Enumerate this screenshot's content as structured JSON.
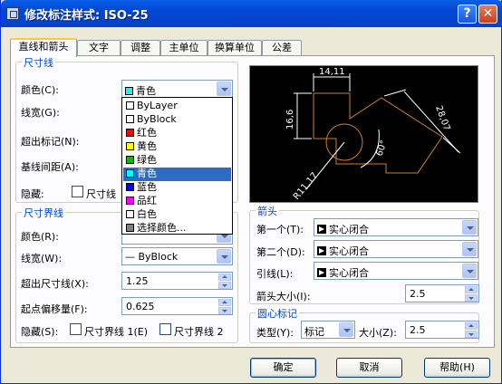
{
  "window": {
    "title": "修改标注样式: ISO-25",
    "help_btn": "?",
    "close_btn": "✕"
  },
  "tabs": [
    "直线和箭头",
    "文字",
    "调整",
    "主单位",
    "换算单位",
    "公差"
  ],
  "dim_lines": {
    "title": "尺寸线",
    "color_label": "颜色(C):",
    "color_value": "青色",
    "lineweight_label": "线宽(G):",
    "extend_label": "超出标记(N):",
    "baseline_label": "基线间距(A):",
    "suppress_label": "隐藏:",
    "suppress_chk": "尺寸线"
  },
  "color_dropdown": {
    "items": [
      {
        "label": "ByLayer",
        "swatch": "#ffffff"
      },
      {
        "label": "ByBlock",
        "swatch": "#ffffff"
      },
      {
        "label": "红色",
        "swatch": "#ff0000"
      },
      {
        "label": "黄色",
        "swatch": "#ffff00"
      },
      {
        "label": "绿色",
        "swatch": "#00c000"
      },
      {
        "label": "青色",
        "swatch": "#00ffff"
      },
      {
        "label": "蓝色",
        "swatch": "#0000ff"
      },
      {
        "label": "品红",
        "swatch": "#ff00ff"
      },
      {
        "label": "白色",
        "swatch": "#ffffff"
      },
      {
        "label": "选择颜色...",
        "swatch": "#808080"
      }
    ],
    "selected": "青色"
  },
  "ext_lines": {
    "title": "尺寸界线",
    "color_label": "颜色(R):",
    "lineweight_label": "线宽(W):",
    "lineweight_value": "— ByBlock",
    "extend_label": "超出尺寸线(X):",
    "extend_value": "1.25",
    "offset_label": "起点偏移量(F):",
    "offset_value": "0.625",
    "suppress_label": "隐藏(S):",
    "chk1": "尺寸界线 1(E)",
    "chk2": "尺寸界线 2"
  },
  "preview": {
    "dim_top": "14,11",
    "dim_left": "16,6",
    "dim_right": "28,07",
    "dim_angle": "60°",
    "dim_radius": "R11,17"
  },
  "arrows": {
    "title": "箭头",
    "first_label": "第一个(T):",
    "first_value": "实心闭合",
    "second_label": "第二个(D):",
    "second_value": "实心闭合",
    "leader_label": "引线(L):",
    "leader_value": "实心闭合",
    "size_label": "箭头大小(I):",
    "size_value": "2.5"
  },
  "center_marks": {
    "title": "圆心标记",
    "type_label": "类型(Y):",
    "type_value": "标记",
    "size_label": "大小(Z):",
    "size_value": "2.5"
  },
  "buttons": {
    "ok": "确定",
    "cancel": "取消",
    "help": "帮助(H)"
  },
  "colors": {
    "accent": "#0046d5",
    "selected": "#316ac5",
    "preview_bg": "#000000",
    "preview_geom": "#d08020",
    "preview_dim": "#ffffff"
  }
}
